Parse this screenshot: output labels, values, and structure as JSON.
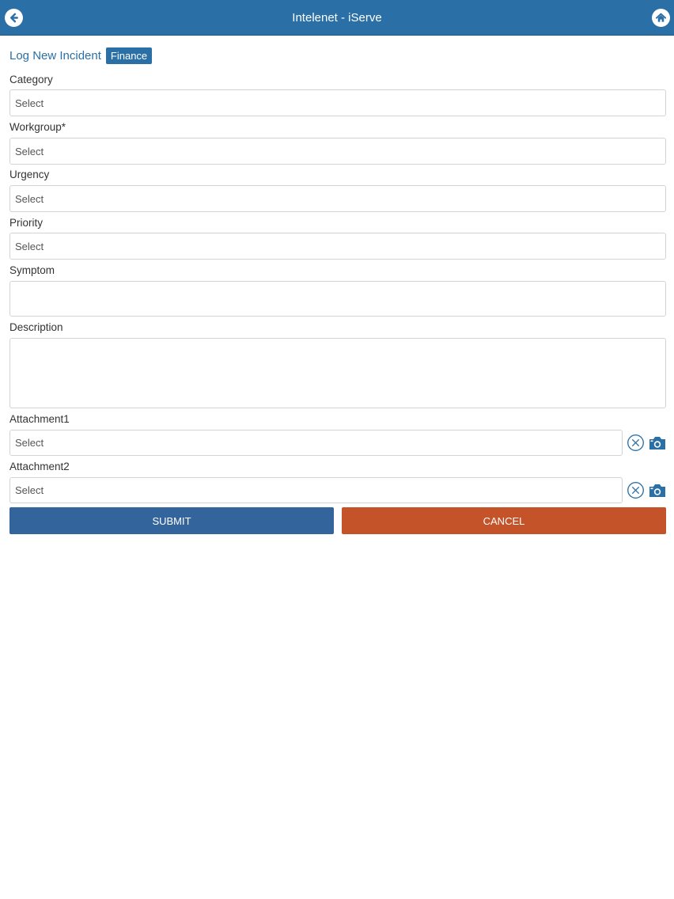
{
  "header": {
    "title": "Intelenet - iServe",
    "back_icon": "arrow-left-circle-icon",
    "home_icon": "home-icon",
    "color": "#2a6fa5"
  },
  "page": {
    "title": "Log New Incident",
    "badge": "Finance"
  },
  "form": {
    "category": {
      "label": "Category",
      "value": "Select"
    },
    "workgroup": {
      "label": "Workgroup*",
      "value": "Select"
    },
    "urgency": {
      "label": "Urgency",
      "value": "Select"
    },
    "priority": {
      "label": "Priority",
      "value": "Select"
    },
    "symptom": {
      "label": "Symptom",
      "value": ""
    },
    "description": {
      "label": "Description",
      "value": ""
    },
    "attachment1": {
      "label": "Attachment1",
      "value": "Select"
    },
    "attachment2": {
      "label": "Attachment2",
      "value": "Select"
    }
  },
  "actions": {
    "submit": "SUBMIT",
    "cancel": "CANCEL",
    "submit_color": "#34649c",
    "cancel_color": "#c4532a"
  }
}
